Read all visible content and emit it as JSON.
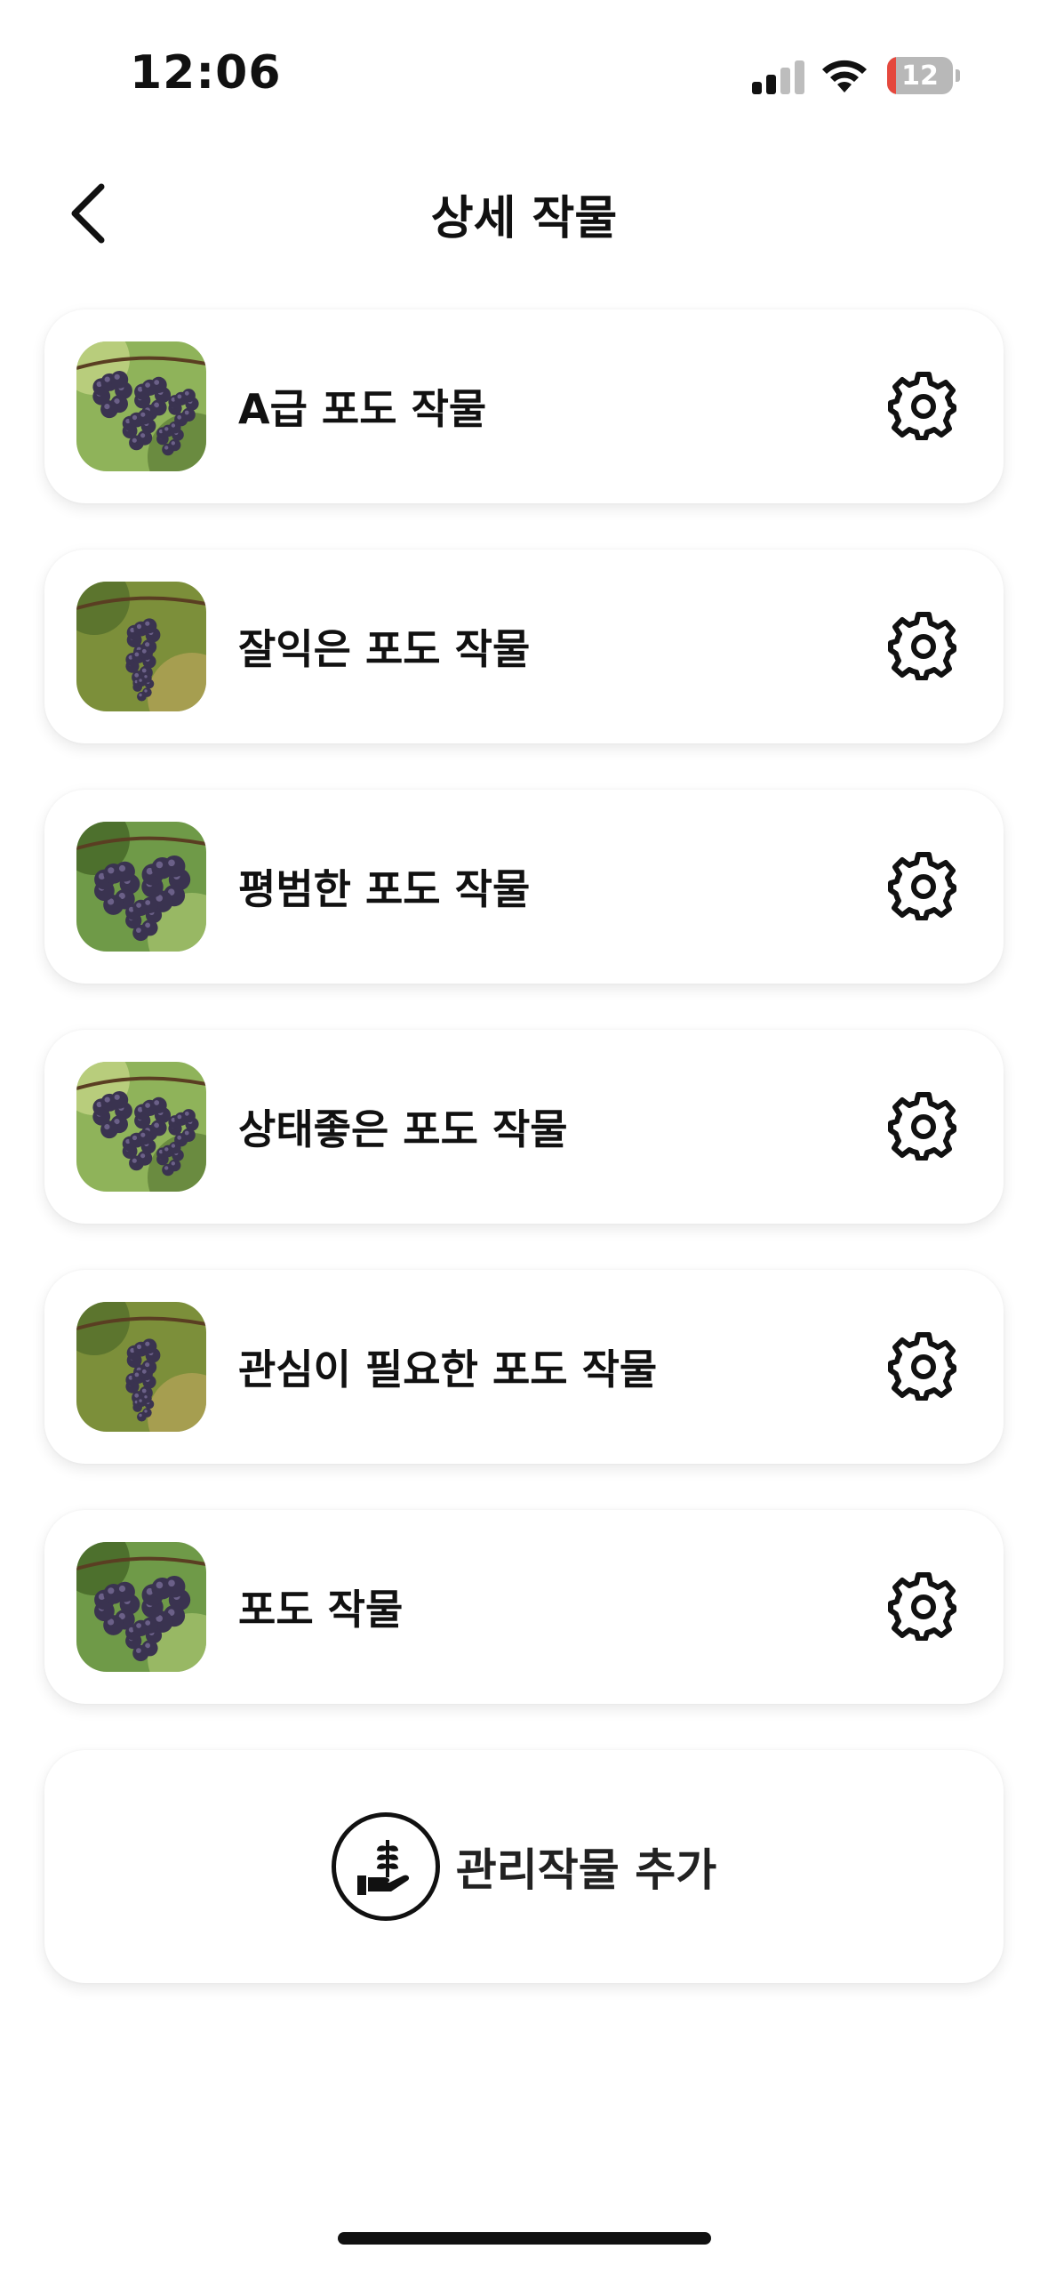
{
  "status_bar": {
    "time": "12:06",
    "battery_level": "12",
    "battery_fill_color": "#e5483d"
  },
  "header": {
    "title": "상세 작물",
    "back_icon": "chevron-left-icon"
  },
  "crops": [
    {
      "name": "A급 포도 작물",
      "thumb_style": "A",
      "action_icon": "gear-icon"
    },
    {
      "name": "잘익은 포도 작물",
      "thumb_style": "B",
      "action_icon": "gear-icon"
    },
    {
      "name": "평범한 포도 작물",
      "thumb_style": "C",
      "action_icon": "gear-icon"
    },
    {
      "name": "상태좋은 포도 작물",
      "thumb_style": "A",
      "action_icon": "gear-icon"
    },
    {
      "name": "관심이 필요한 포도 작물",
      "thumb_style": "B",
      "action_icon": "gear-icon"
    },
    {
      "name": "포도 작물",
      "thumb_style": "C",
      "action_icon": "gear-icon"
    }
  ],
  "add_crop": {
    "label": "관리작물 추가",
    "icon": "plant-in-hand-icon"
  },
  "colors": {
    "background": "#ffffff",
    "text": "#111111",
    "card_shadow": "rgba(0,0,0,0.09)"
  }
}
